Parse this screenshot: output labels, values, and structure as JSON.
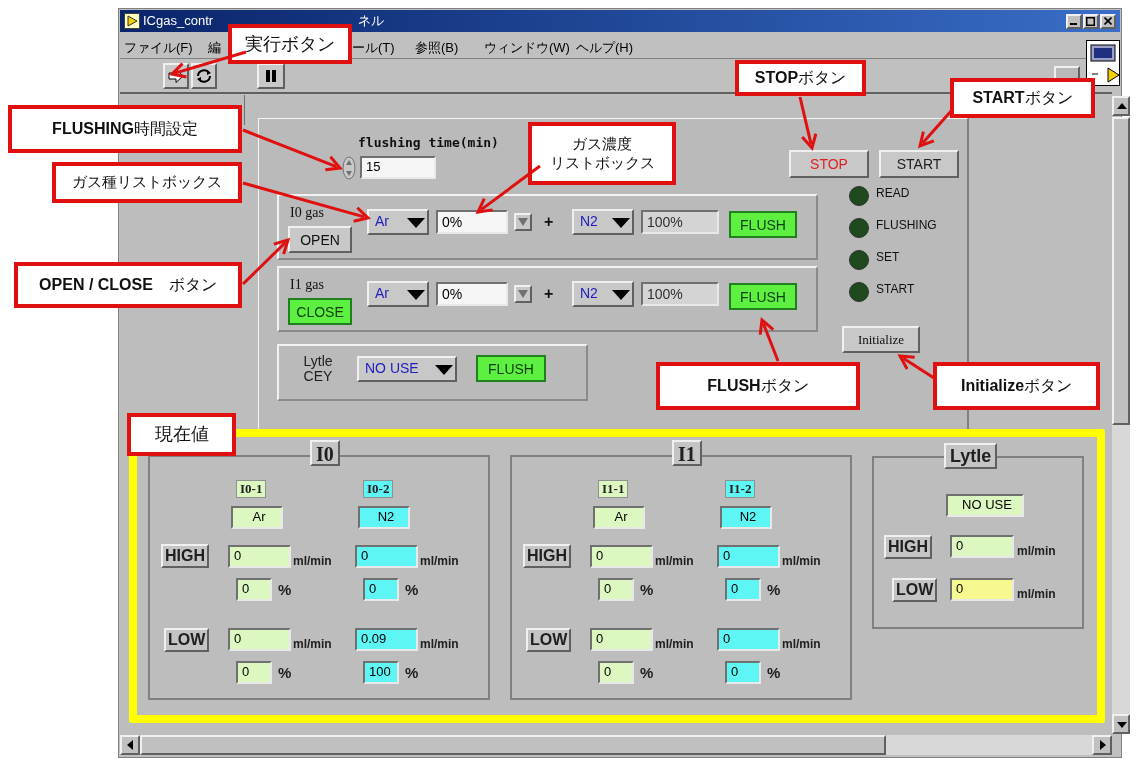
{
  "window": {
    "title_start": "ICgas_contr",
    "title_end": "ネル"
  },
  "menu": [
    "ファイル(F)",
    "編",
    "ール(T)",
    "参照(B)",
    "ウィンドウ(W)",
    "ヘルプ(H)"
  ],
  "flushing_time": {
    "label": "flushing time(min)",
    "value": "15"
  },
  "run_buttons": [
    {
      "label": "STOP",
      "kind": "stop"
    },
    {
      "label": "START",
      "kind": "plain"
    }
  ],
  "indicators": [
    {
      "label": "READ",
      "on": false
    },
    {
      "label": "FLUSHING",
      "on": false
    },
    {
      "label": "SET",
      "on": false
    },
    {
      "label": "START",
      "on": false
    }
  ],
  "initialize_button": "Initialize",
  "gas_lines": [
    {
      "label": "I0 gas",
      "valve": {
        "label": "OPEN",
        "lit": false
      },
      "gas_1": "Ar",
      "concentration_1": "0%",
      "plus": "+",
      "gas_2": "N2",
      "concentration_2": "100%",
      "flush": {
        "label": "FLUSH",
        "lit": true
      }
    },
    {
      "label": "I1 gas",
      "valve": {
        "label": "CLOSE",
        "lit": true
      },
      "gas_1": "Ar",
      "concentration_1": "0%",
      "plus": "+",
      "gas_2": "N2",
      "concentration_2": "100%",
      "flush": {
        "label": "FLUSH",
        "lit": true
      }
    }
  ],
  "lytle_line": {
    "label": "Lytle\nCEY",
    "gas": "NO USE",
    "flush": {
      "label": "FLUSH",
      "lit": true
    }
  },
  "current_values": {
    "groups": [
      {
        "title": "I0",
        "row_labels": [
          "HIGH",
          "LOW"
        ],
        "channels": [
          {
            "name": "I0-1",
            "gas": "Ar",
            "color": "#dcf7c0",
            "high": {
              "flow": "0",
              "flow_unit": "ml/min",
              "percent": "0",
              "percent_unit": "%"
            },
            "low": {
              "flow": "0",
              "flow_unit": "ml/min",
              "percent": "0",
              "percent_unit": "%"
            }
          },
          {
            "name": "I0-2",
            "gas": "N2",
            "color": "#5ef5f5",
            "high": {
              "flow": "0",
              "flow_unit": "ml/min",
              "percent": "0",
              "percent_unit": "%"
            },
            "low": {
              "flow": "0.09",
              "flow_unit": "ml/min",
              "percent": "100",
              "percent_unit": "%"
            }
          }
        ]
      },
      {
        "title": "I1",
        "row_labels": [
          "HIGH",
          "LOW"
        ],
        "channels": [
          {
            "name": "I1-1",
            "gas": "Ar",
            "color": "#dcf7c0",
            "high": {
              "flow": "0",
              "flow_unit": "ml/min",
              "percent": "0",
              "percent_unit": "%"
            },
            "low": {
              "flow": "0",
              "flow_unit": "ml/min",
              "percent": "0",
              "percent_unit": "%"
            }
          },
          {
            "name": "I1-2",
            "gas": "N2",
            "color": "#5ef5f5",
            "high": {
              "flow": "0",
              "flow_unit": "ml/min",
              "percent": "0",
              "percent_unit": "%"
            },
            "low": {
              "flow": "0",
              "flow_unit": "ml/min",
              "percent": "0",
              "percent_unit": "%"
            }
          }
        ]
      }
    ],
    "lytle": {
      "title": "Lytle",
      "gas": "NO USE",
      "rows": [
        {
          "label": "HIGH",
          "flow": "0",
          "unit": "ml/min",
          "color": "#dcf7c0"
        },
        {
          "label": "LOW",
          "flow": "0",
          "unit": "ml/min",
          "color": "#f8f890"
        }
      ]
    }
  },
  "annotations": [
    {
      "lines": [
        "実行ボタン"
      ]
    },
    {
      "lines": [
        "**STOP**ボタン"
      ]
    },
    {
      "lines": [
        "**START**ボタン"
      ]
    },
    {
      "lines": [
        "**FLUSHING**時間設定"
      ]
    },
    {
      "lines": [
        "ガス種リストボックス"
      ]
    },
    {
      "lines": [
        "ガス濃度",
        "リストボックス"
      ]
    },
    {
      "lines": [
        "**OPEN / CLOSE**　ボタン"
      ]
    },
    {
      "lines": [
        "**FLUSH**ボタン"
      ]
    },
    {
      "lines": [
        "**Initialize**ボタン"
      ]
    },
    {
      "lines": [
        "現在値"
      ]
    }
  ]
}
